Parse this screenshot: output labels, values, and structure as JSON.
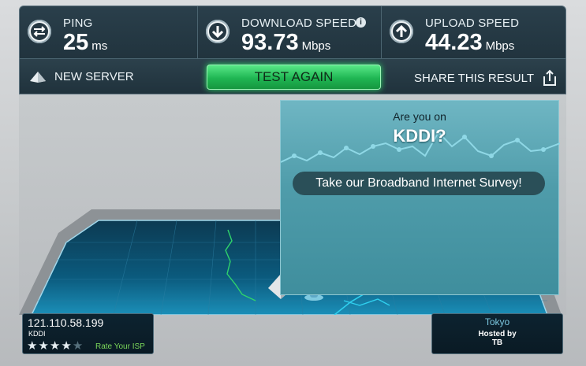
{
  "stats": {
    "ping": {
      "label": "PING",
      "value": "25",
      "unit": "ms"
    },
    "download": {
      "label": "DOWNLOAD SPEED",
      "value": "93.73",
      "unit": "Mbps",
      "info": "i"
    },
    "upload": {
      "label": "UPLOAD SPEED",
      "value": "44.23",
      "unit": "Mbps"
    }
  },
  "actions": {
    "new_server": "NEW SERVER",
    "test_again": "TEST AGAIN",
    "share": "SHARE THIS RESULT"
  },
  "survey": {
    "line1": "Are you on",
    "line2": "KDDI?",
    "button": "Take our Broadband Internet Survey!"
  },
  "client": {
    "ip": "121.110.58.199",
    "isp": "KDDI",
    "stars_filled": "★★★★",
    "stars_empty": "★",
    "rating": 4,
    "rate_link": "Rate Your ISP"
  },
  "server": {
    "city": "Tokyo",
    "hosted_by": "Hosted by",
    "host": "TB"
  },
  "colors": {
    "panel": "#1f313b",
    "accent_green": "#1fb653",
    "survey_teal": "#4f9caa",
    "map_line": "#2fd0ef"
  },
  "icons": {
    "ping": "exchange-arrows-icon",
    "download": "arrow-down-icon",
    "upload": "arrow-up-icon",
    "new_server": "pyramid-icon",
    "share": "share-upload-icon"
  }
}
